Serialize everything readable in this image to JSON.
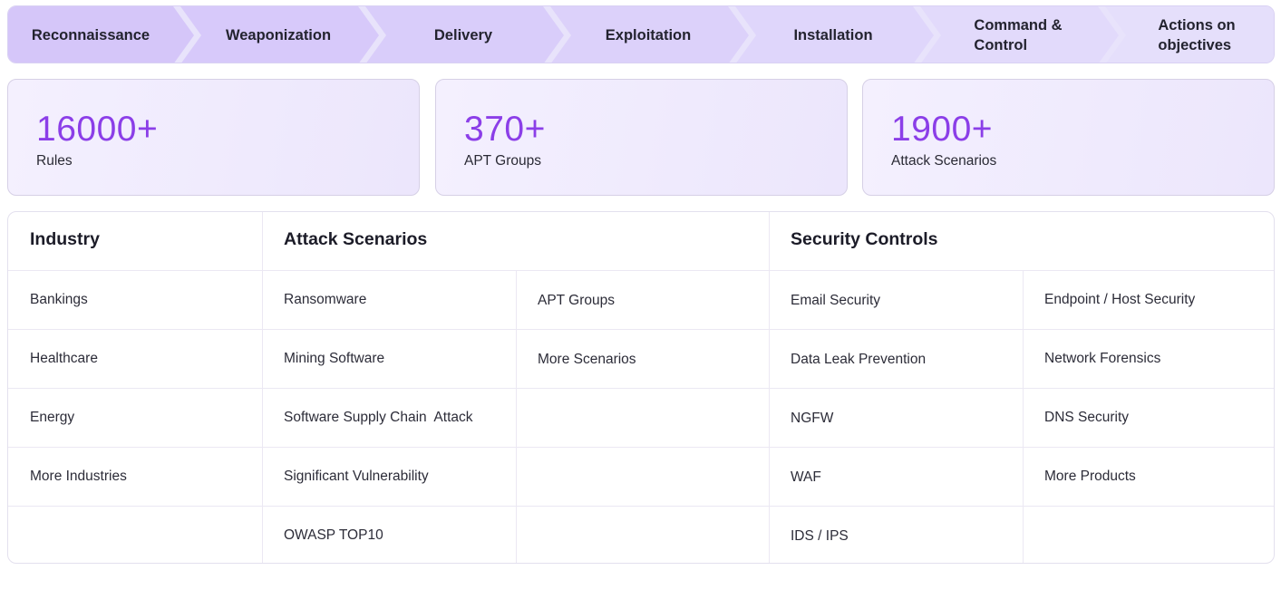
{
  "kill_chain": {
    "steps": [
      "Reconnaissance",
      "Weaponization",
      "Delivery",
      "Exploitation",
      "Installation",
      [
        "Command &",
        "Control"
      ],
      [
        "Actions on",
        "objectives"
      ]
    ]
  },
  "stats": [
    {
      "value": "16000+",
      "label": "Rules"
    },
    {
      "value": "370+",
      "label": "APT Groups"
    },
    {
      "value": "1900+",
      "label": "Attack Scenarios"
    }
  ],
  "table": {
    "headers": {
      "industry": "Industry",
      "attack": "Attack Scenarios",
      "security": "Security Controls"
    },
    "industry": [
      "Bankings",
      "Healthcare",
      "Energy",
      "More Industries",
      ""
    ],
    "attack_col1": [
      "Ransomware",
      "Mining Software",
      "Software Supply Chain  Attack",
      "Significant Vulnerability",
      "OWASP TOP10"
    ],
    "attack_col2": [
      "APT Groups",
      "More Scenarios",
      "",
      "",
      ""
    ],
    "security_col1": [
      "Email Security",
      "Data Leak Prevention",
      "NGFW",
      "WAF",
      "IDS / IPS"
    ],
    "security_col2": [
      "Endpoint / Host Security",
      "Network Forensics",
      "DNS Security",
      "More Products",
      ""
    ]
  },
  "colors": {
    "accent": "#8b3ee8",
    "chain_light": "#e6e1fb",
    "chain_mid": "#d9cefa",
    "chain_dark": "#cdb9f8"
  }
}
